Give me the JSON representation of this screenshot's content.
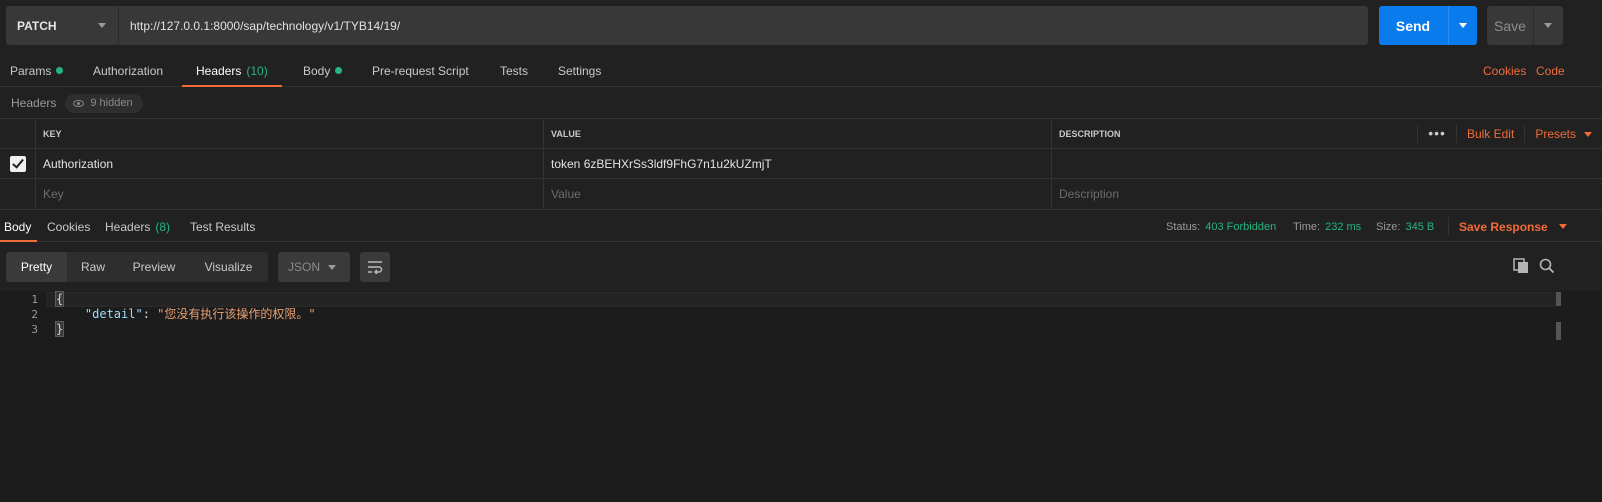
{
  "request": {
    "method": "PATCH",
    "url": "http://127.0.0.1:8000/sap/technology/v1/TYB14/19/",
    "send_label": "Send",
    "save_label": "Save"
  },
  "request_tabs": {
    "params": "Params",
    "authorization": "Authorization",
    "headers": "Headers",
    "headers_count": "(10)",
    "body": "Body",
    "prerequest": "Pre-request Script",
    "tests": "Tests",
    "settings": "Settings",
    "cookies_link": "Cookies",
    "code_link": "Code"
  },
  "headers_panel": {
    "title": "Headers",
    "hidden_label": "9 hidden",
    "columns": {
      "key": "KEY",
      "value": "VALUE",
      "description": "DESCRIPTION"
    },
    "more_label": "•••",
    "bulk_edit": "Bulk Edit",
    "presets": "Presets",
    "rows": [
      {
        "checked": true,
        "key": "Authorization",
        "value": "token 6zBEHXrSs3ldf9FhG7n1u2kUZmjT",
        "description": ""
      }
    ],
    "placeholder": {
      "key": "Key",
      "value": "Value",
      "description": "Description"
    }
  },
  "response_tabs": {
    "body": "Body",
    "cookies": "Cookies",
    "headers": "Headers",
    "headers_count": "(8)",
    "test_results": "Test Results"
  },
  "response_status": {
    "status_label": "Status:",
    "status_value": "403 Forbidden",
    "time_label": "Time:",
    "time_value": "232 ms",
    "size_label": "Size:",
    "size_value": "345 B",
    "save_response": "Save Response"
  },
  "view_modes": {
    "pretty": "Pretty",
    "raw": "Raw",
    "preview": "Preview",
    "visualize": "Visualize",
    "format": "JSON"
  },
  "response_body": {
    "line_numbers": [
      "1",
      "2",
      "3"
    ],
    "open_brace": "{",
    "indent": "    ",
    "key": "\"detail\"",
    "colon": ": ",
    "value": "\"您没有执行该操作的权限。\"",
    "close_brace": "}"
  },
  "colors": {
    "accent": "#f26b3a",
    "send": "#097bed",
    "success": "#26b47f",
    "background": "#212121"
  },
  "icons": [
    "caret-down-icon",
    "eye-icon",
    "check-icon",
    "wrap-lines-icon",
    "copy-icon",
    "search-icon"
  ]
}
